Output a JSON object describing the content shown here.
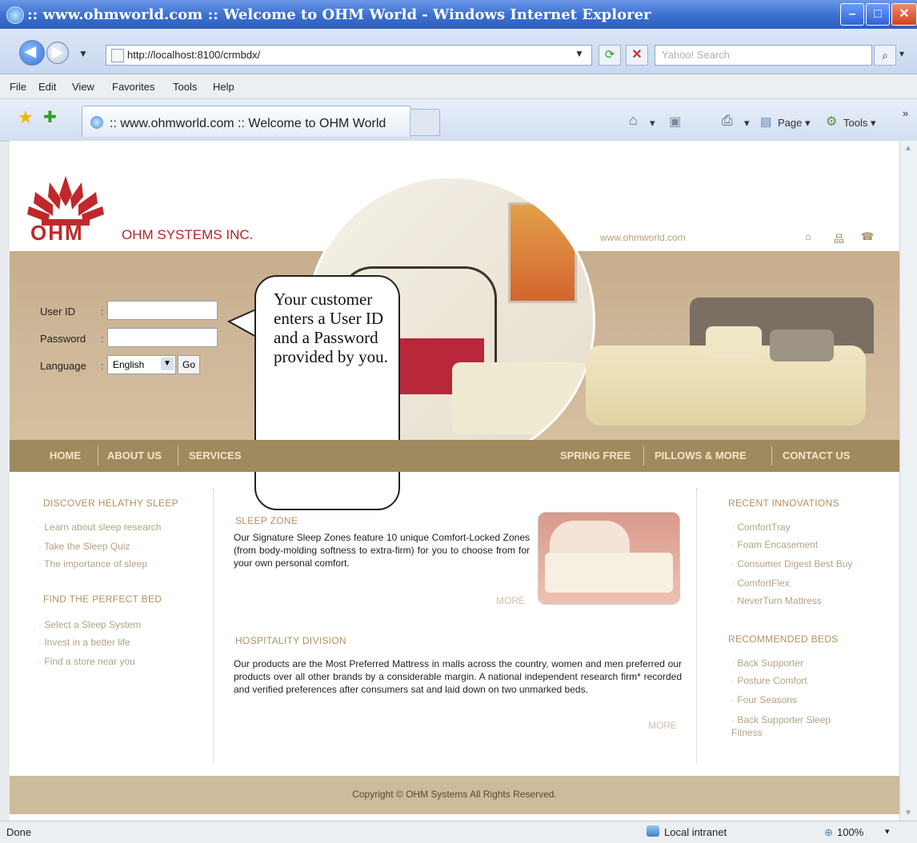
{
  "window": {
    "title": ":: www.ohmworld.com :: Welcome to OHM World - Windows Internet Explorer",
    "address": "http://localhost:8100/crmbdx/",
    "search_placeholder": "Yahoo! Search"
  },
  "menu": [
    "File",
    "Edit",
    "View",
    "Favorites",
    "Tools",
    "Help"
  ],
  "tab": {
    "label": ":: www.ohmworld.com :: Welcome to OHM World"
  },
  "toolbar": {
    "page": "Page",
    "tools": "Tools"
  },
  "site": {
    "logo": "OHM",
    "company": "OHM SYSTEMS INC.",
    "url": "www.ohmworld.com"
  },
  "login": {
    "user_label": "User ID",
    "password_label": "Password",
    "language_label": "Language",
    "language_value": "English",
    "go_label": "Go"
  },
  "callout": "Your customer enters a User ID and a Password provided by you.",
  "nav": [
    "HOME",
    "ABOUT US",
    "SERVICES",
    "SPRING FREE",
    "PILLOWS & MORE",
    "CONTACT US"
  ],
  "left": {
    "heading1": "DISCOVER HELATHY SLEEP",
    "links1": [
      "Learn about sleep research",
      "Take the Sleep Quiz",
      "The importance of sleep"
    ],
    "heading2": "FIND THE PERFECT BED",
    "links2": [
      "Select a Sleep System",
      "Invest in a better life",
      "Find a store near you"
    ]
  },
  "center": {
    "sleep_zone_title": "SLEEP ZONE",
    "sleep_zone_text": "Our Signature Sleep Zones feature 10 unique Comfort-Locked Zones (from body-molding softness to extra-firm) for you to choose from for your own personal comfort.",
    "more1": "MORE",
    "hospitality_title": "HOSPITALITY DIVISION",
    "hospitality_text": "Our products are the Most Preferred Mattress in malls across the country, women and men preferred our products over all other brands by a considerable margin. A national independent research firm* recorded and verified preferences after consumers sat and laid down on two unmarked beds.",
    "more2": "MORE"
  },
  "right": {
    "heading1": "RECENT INNOVATIONS",
    "links1": [
      "ComfortTray",
      "Foam Encasement",
      "Consumer Digest Best Buy",
      "ComfortFlex",
      "NeverTurn Mattress"
    ],
    "heading2": "RECOMMENDED BEDS",
    "links2": [
      "Back Supporter",
      "Posture Comfort",
      "Four Seasons",
      "Back Supporter Sleep Fitness"
    ]
  },
  "footer": "Copyright © OHM Systems All Rights Reserved.",
  "status": {
    "left": "Done",
    "zone": "Local intranet",
    "zoom": "100%"
  }
}
